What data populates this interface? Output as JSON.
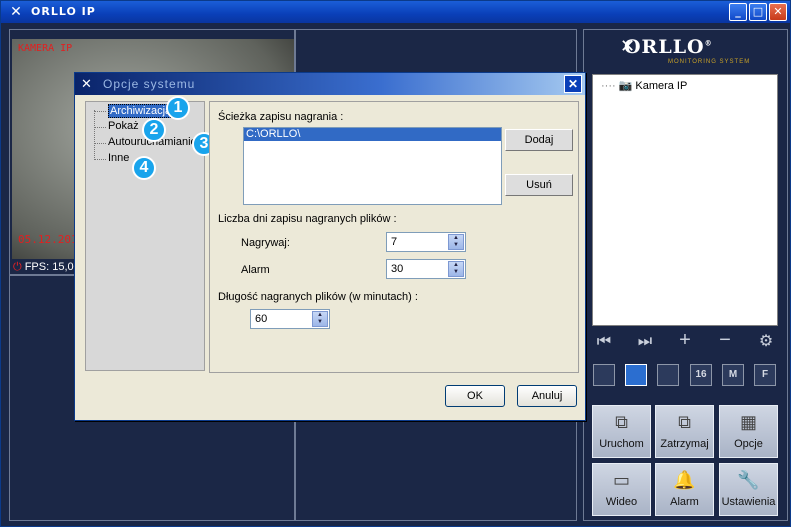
{
  "app": {
    "title": "ORLLO IP",
    "window_buttons": [
      "_",
      "□",
      "✕"
    ]
  },
  "camera_view": {
    "overlay_label": "KAMERA IP",
    "date": "05.12.2016",
    "fps_label": "FPS: 15,0"
  },
  "brand": {
    "name": "ORLLO",
    "subtitle": "MONITORING SYSTEM",
    "registered": "®"
  },
  "camera_tree": {
    "items": [
      {
        "label": "Kamera IP"
      }
    ]
  },
  "controls": {
    "first": "⏮",
    "last": "⏭",
    "add": "+",
    "remove": "−",
    "settings": "⚙"
  },
  "layouts": [
    "",
    "",
    "",
    "16",
    "M",
    "F"
  ],
  "action_buttons": [
    {
      "label": "Uruchom",
      "icon": "start-icon"
    },
    {
      "label": "Zatrzymaj",
      "icon": "stop-icon"
    },
    {
      "label": "Opcje",
      "icon": "options-icon"
    },
    {
      "label": "Wideo",
      "icon": "video-icon"
    },
    {
      "label": "Alarm",
      "icon": "bell-icon"
    },
    {
      "label": "Ustawienia",
      "icon": "wrench-icon"
    }
  ],
  "dialog": {
    "title": "Opcje systemu",
    "nav": [
      "Archiwizacja",
      "Pokaż",
      "Autouruchamianie",
      "Inne"
    ],
    "badges": [
      "1",
      "2",
      "3",
      "4"
    ],
    "path_label": "Ścieżka zapisu nagrania :",
    "paths": [
      "C:\\ORLLO\\"
    ],
    "add_label": "Dodaj",
    "remove_label": "Usuń",
    "days_label": "Liczba dni zapisu nagranych plików :",
    "record_label": "Nagrywaj:",
    "record_value": "7",
    "alarm_label": "Alarm",
    "alarm_value": "30",
    "length_label": "Długość nagranych plików (w minutach) :",
    "length_value": "60",
    "ok_label": "OK",
    "cancel_label": "Anuluj"
  }
}
